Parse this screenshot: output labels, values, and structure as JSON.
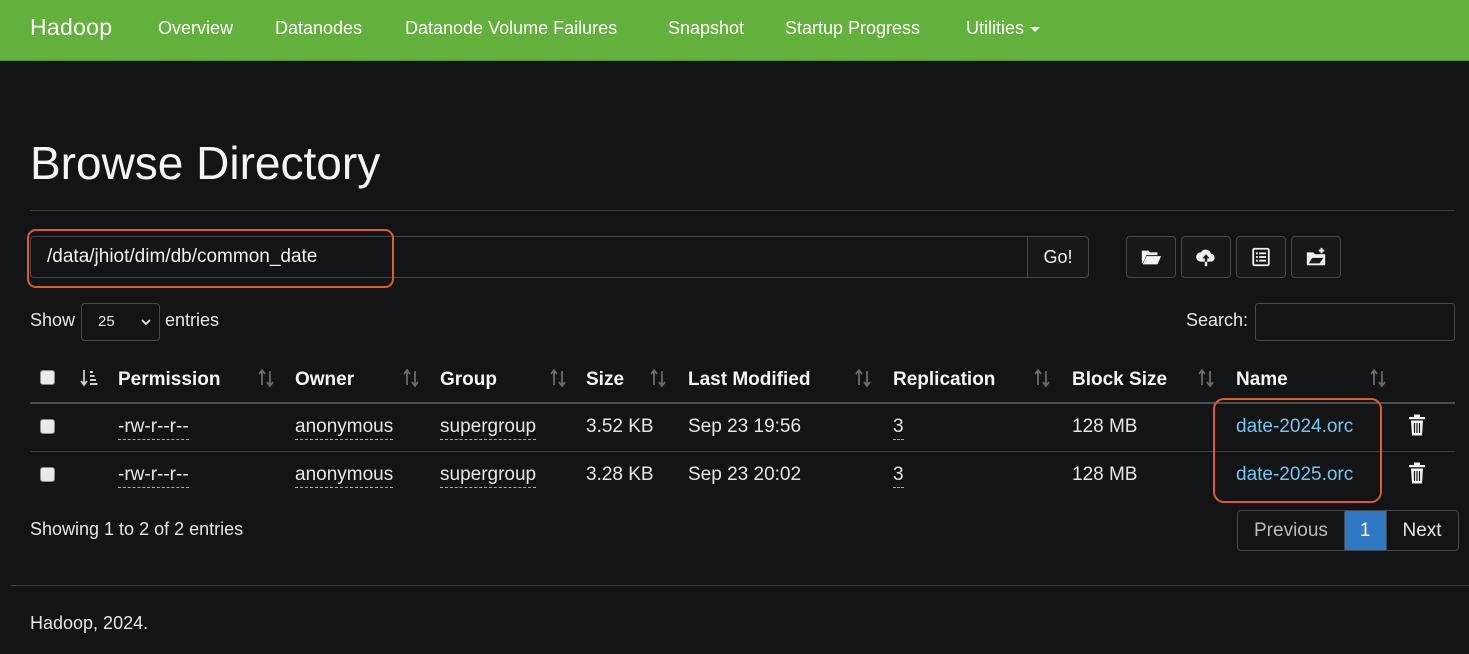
{
  "navbar": {
    "brand": "Hadoop",
    "links": [
      "Overview",
      "Datanodes",
      "Datanode Volume Failures",
      "Snapshot",
      "Startup Progress",
      "Utilities"
    ]
  },
  "page": {
    "title": "Browse Directory"
  },
  "path_form": {
    "value": "/data/jhiot/dim/db/common_date",
    "go_label": "Go!"
  },
  "toolbar": {
    "icons": [
      "folder-open-icon",
      "cloud-upload-icon",
      "list-alt-icon",
      "new-folder-icon"
    ]
  },
  "controls": {
    "show_label": "Show",
    "page_size": "25",
    "entries_label": "entries",
    "search_label": "Search:"
  },
  "table": {
    "columns": [
      "Permission",
      "Owner",
      "Group",
      "Size",
      "Last Modified",
      "Replication",
      "Block Size",
      "Name"
    ],
    "rows": [
      {
        "permission": "-rw-r--r--",
        "owner": "anonymous",
        "group": "supergroup",
        "size": "3.52 KB",
        "modified": "Sep 23 19:56",
        "replication": "3",
        "block_size": "128 MB",
        "name": "date-2024.orc"
      },
      {
        "permission": "-rw-r--r--",
        "owner": "anonymous",
        "group": "supergroup",
        "size": "3.28 KB",
        "modified": "Sep 23 20:02",
        "replication": "3",
        "block_size": "128 MB",
        "name": "date-2025.orc"
      }
    ]
  },
  "info": "Showing 1 to 2 of 2 entries",
  "pagination": {
    "previous": "Previous",
    "current": "1",
    "next": "Next"
  },
  "footer": "Hadoop, 2024.",
  "colors": {
    "navbar": "#62b13c",
    "background": "#121416",
    "link": "#6ec8f2",
    "highlight": "#e35b23",
    "active_page": "#2f78c4"
  }
}
